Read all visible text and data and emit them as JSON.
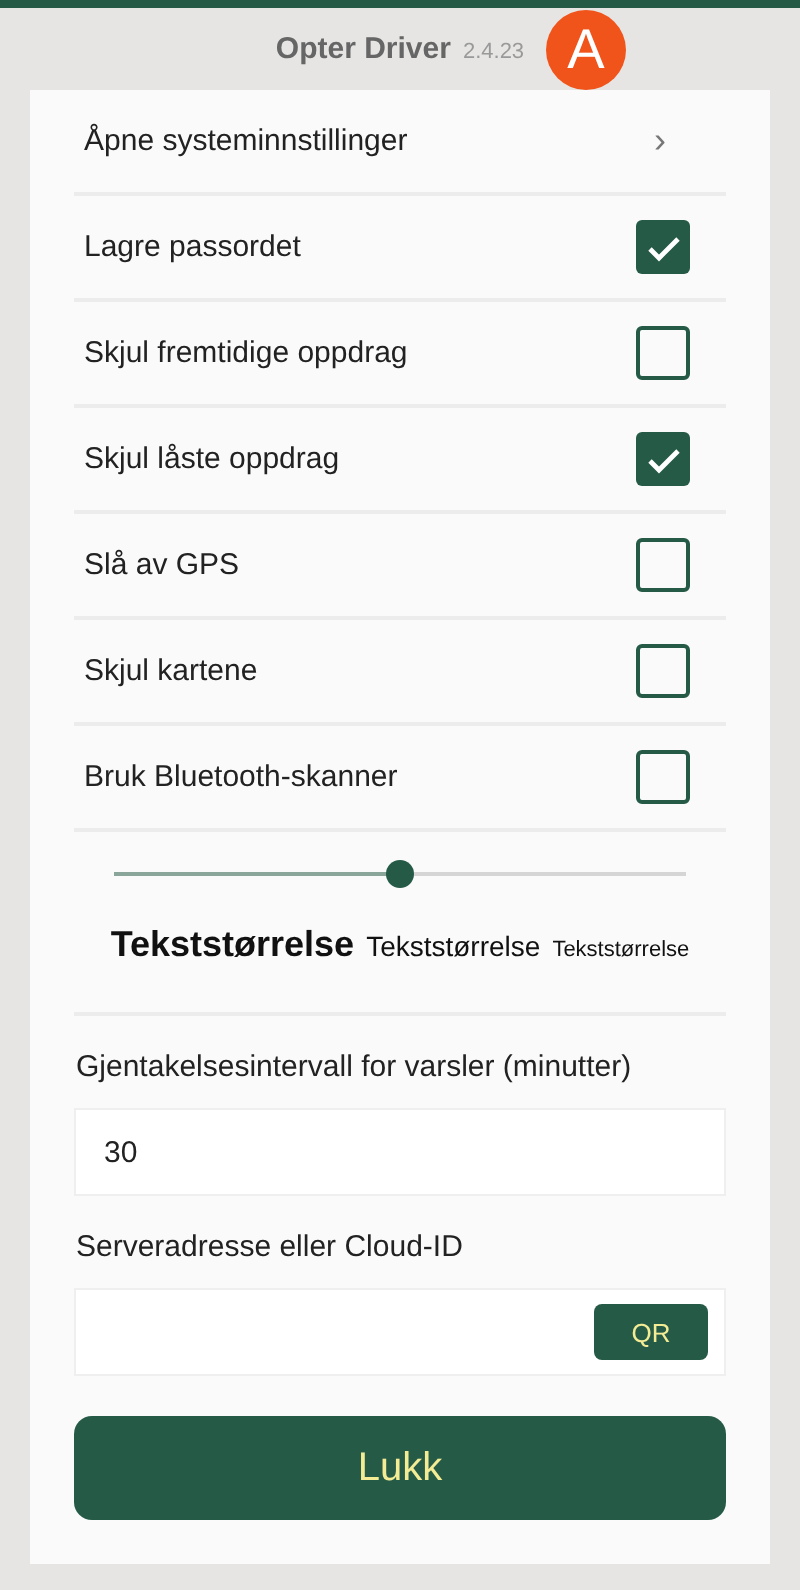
{
  "header": {
    "title": "Opter Driver",
    "version": "2.4.23",
    "badge": "A"
  },
  "link_row": {
    "label": "Åpne systeminnstillinger",
    "chevron": "›"
  },
  "options": [
    {
      "label": "Lagre passordet",
      "checked": true
    },
    {
      "label": "Skjul fremtidige oppdrag",
      "checked": false
    },
    {
      "label": "Skjul låste oppdrag",
      "checked": true
    },
    {
      "label": "Slå av GPS",
      "checked": false
    },
    {
      "label": "Skjul kartene",
      "checked": false
    },
    {
      "label": "Bruk Bluetooth-skanner",
      "checked": false
    }
  ],
  "text_size": {
    "level": 0.5,
    "samples": [
      "Tekststørrelse",
      "Tekststørrelse",
      "Tekststørrelse"
    ]
  },
  "interval": {
    "label": "Gjentakelsesintervall for varsler (minutter)",
    "value": "30"
  },
  "server": {
    "label": "Serveradresse eller Cloud-ID",
    "qr_button": "QR"
  },
  "close_button": "Lukk"
}
